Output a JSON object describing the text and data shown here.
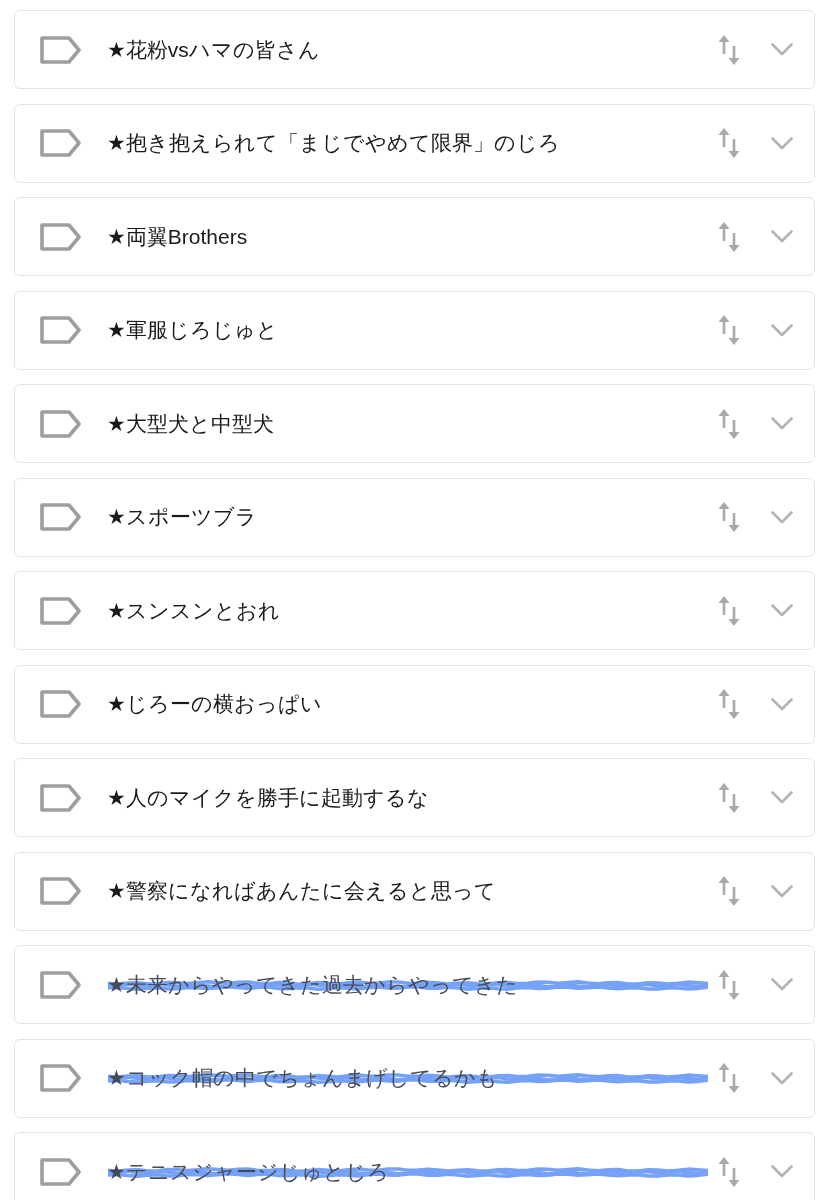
{
  "items": [
    {
      "title": "★花粉vsハマの皆さん",
      "struck": false
    },
    {
      "title": "★抱き抱えられて「まじでやめて限界」のじろ",
      "struck": false
    },
    {
      "title": "★両翼Brothers",
      "struck": false
    },
    {
      "title": "★軍服じろじゅと",
      "struck": false
    },
    {
      "title": "★大型犬と中型犬",
      "struck": false
    },
    {
      "title": "★スポーツブラ",
      "struck": false
    },
    {
      "title": "★スンスンとおれ",
      "struck": false
    },
    {
      "title": "★じろーの横おっぱい",
      "struck": false
    },
    {
      "title": "★人のマイクを勝手に起動するな",
      "struck": false
    },
    {
      "title": "★警察になればあんたに会えると思って",
      "struck": false
    },
    {
      "title": "★未来からやってきた過去からやってきた",
      "struck": true
    },
    {
      "title": "★コック帽の中でちょんまげしてるかも",
      "struck": true
    },
    {
      "title": "★テニスジャージじゅとじろ",
      "struck": true
    }
  ]
}
